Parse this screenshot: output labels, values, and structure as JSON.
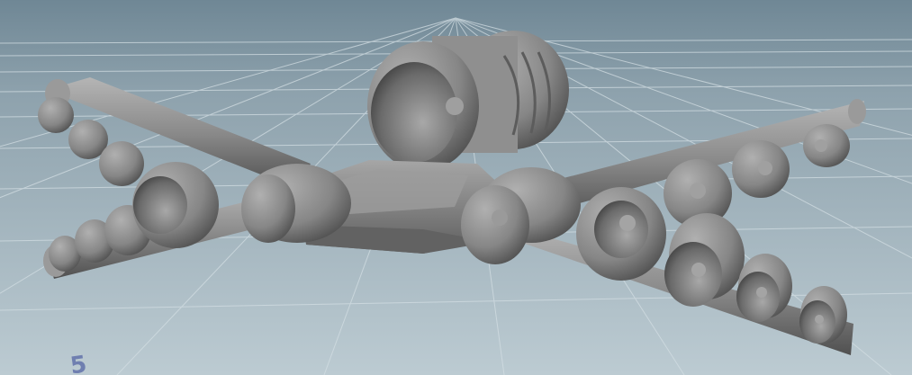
{
  "viewport": {
    "grid_label": "5",
    "colors": {
      "sky_top": "#6f8795",
      "floor_far": "#9aacb6",
      "floor_near": "#b9c8cf",
      "grid_line": "#d5e0e5",
      "model": "#8c8c8c",
      "label": "#6f7fb0"
    }
  }
}
